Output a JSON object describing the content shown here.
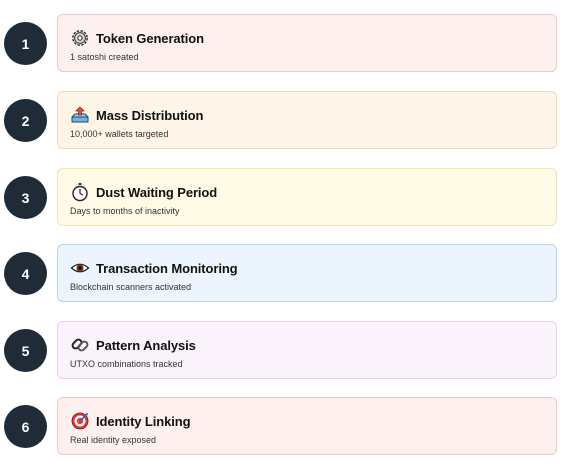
{
  "steps": [
    {
      "number": "1",
      "title": "Token Generation",
      "subtitle": "1 satoshi created",
      "icon": "gear-icon",
      "bg": "#fff0f0",
      "border": "#f5c6c6"
    },
    {
      "number": "2",
      "title": "Mass Distribution",
      "subtitle": "10,000+ wallets targeted",
      "icon": "outbox-tray-icon",
      "bg": "#fff4e8",
      "border": "#f5d7b0"
    },
    {
      "number": "3",
      "title": "Dust Waiting Period",
      "subtitle": "Days to months of inactivity",
      "icon": "stopwatch-icon",
      "bg": "#fffbe6",
      "border": "#f3e6a6"
    },
    {
      "number": "4",
      "title": "Transaction Monitoring",
      "subtitle": "Blockchain scanners activated",
      "icon": "eye-icon",
      "bg": "#ecf5fd",
      "border": "#b9d6f0"
    },
    {
      "number": "5",
      "title": "Pattern Analysis",
      "subtitle": "UTXO combinations tracked",
      "icon": "chain-link-icon",
      "bg": "#fbf3fb",
      "border": "#ead3ea"
    },
    {
      "number": "6",
      "title": "Identity Linking",
      "subtitle": "Real identity exposed",
      "icon": "target-icon",
      "bg": "#fff0f0",
      "border": "#f5c6c6"
    }
  ]
}
